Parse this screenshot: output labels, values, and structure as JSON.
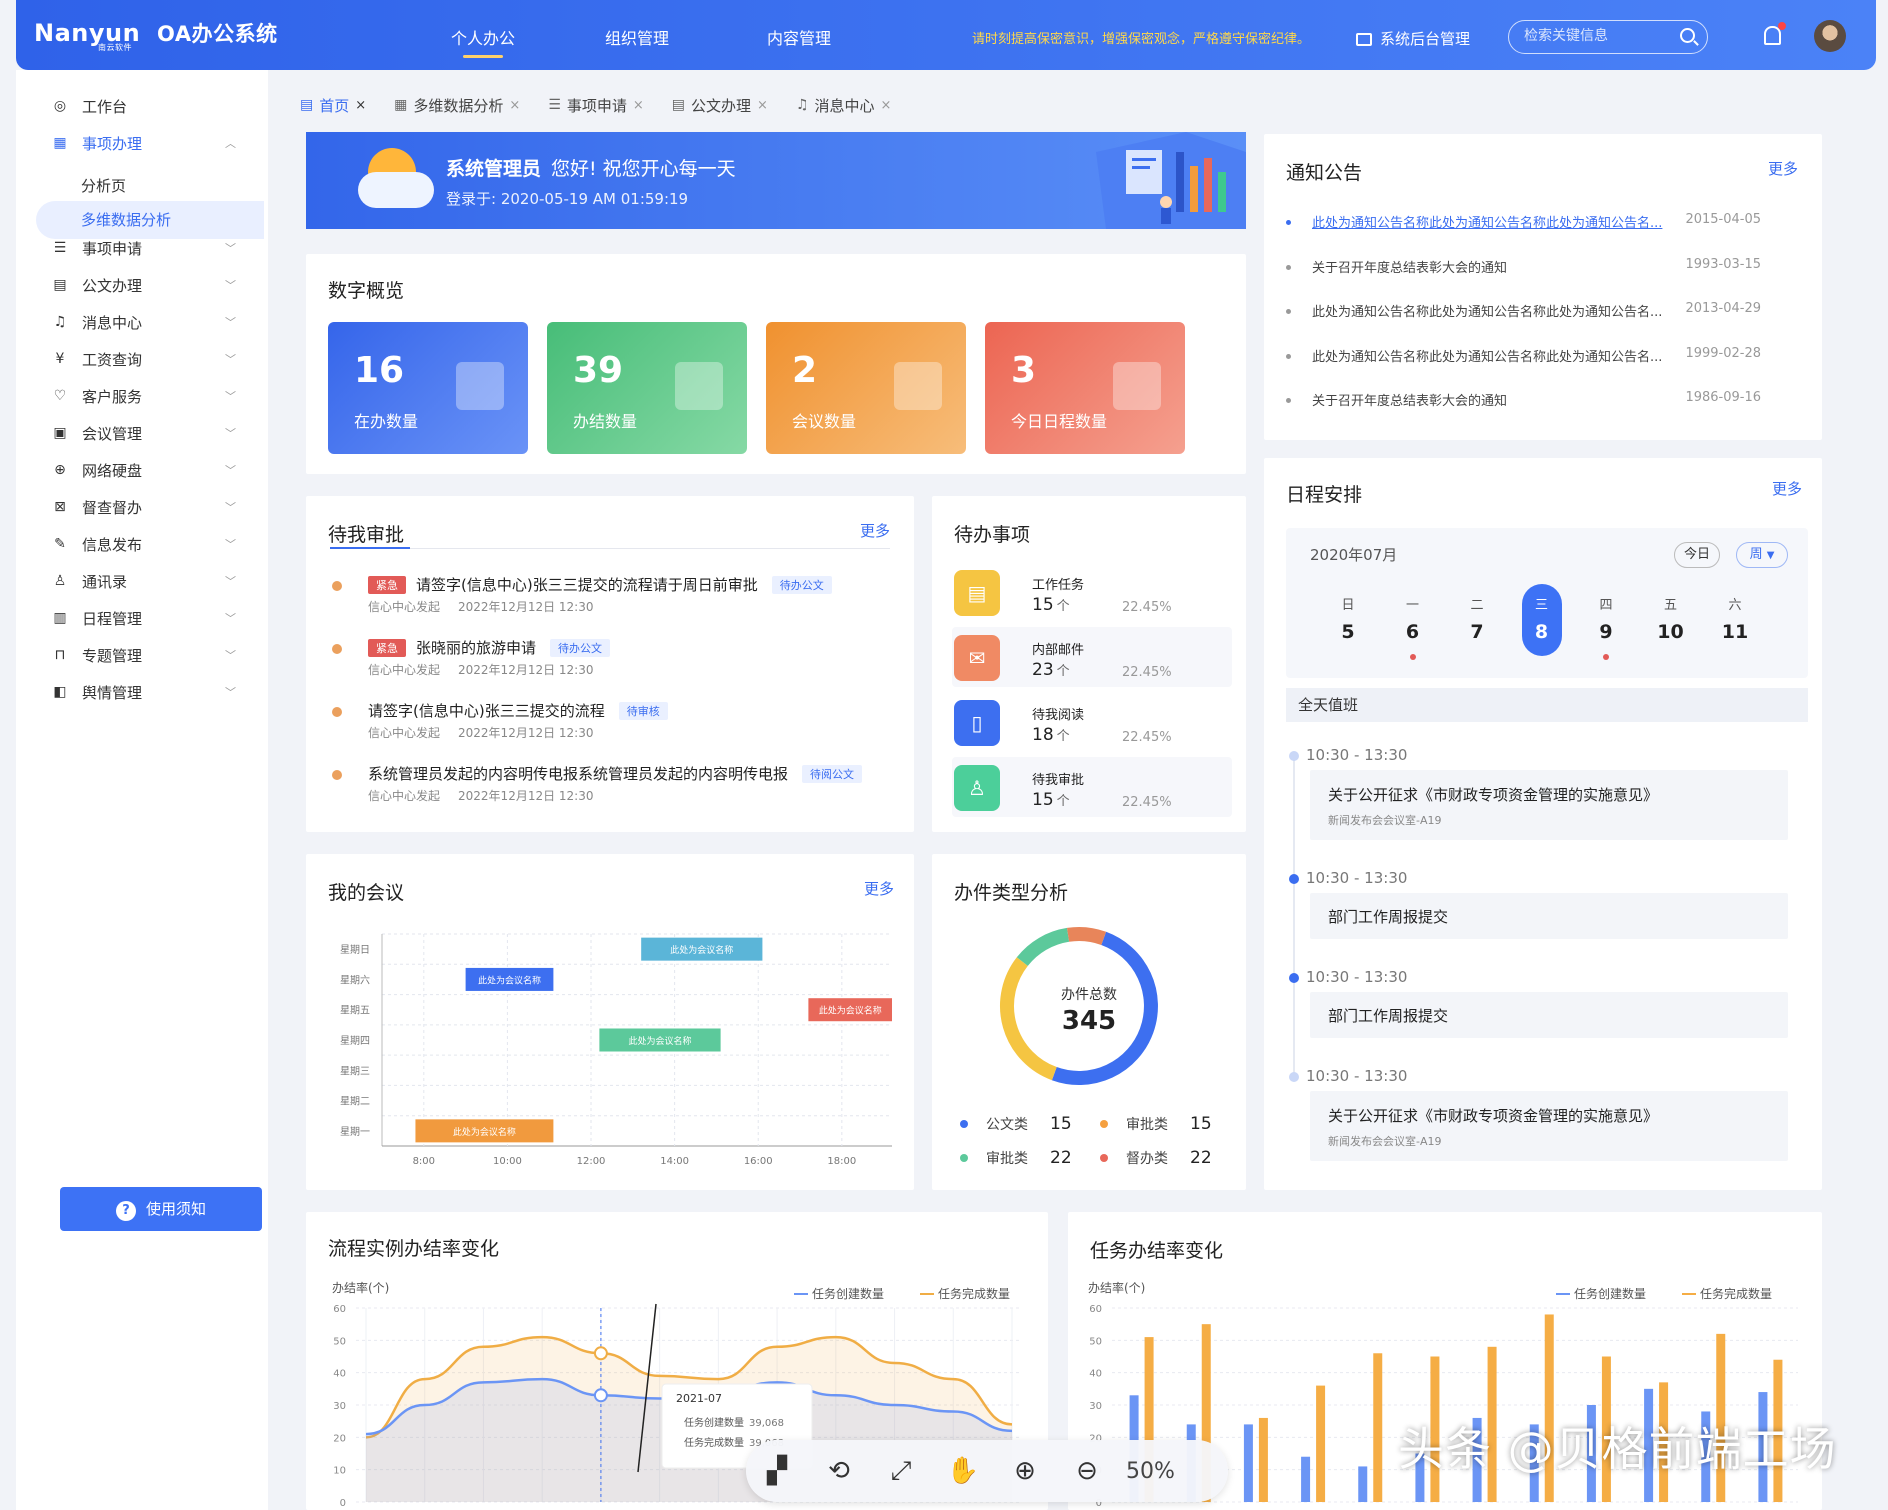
{
  "header": {
    "logo": "Nanyun",
    "logo_sub": "南云软件",
    "system_name": "OA办公系统",
    "nav": [
      "个人办公",
      "组织管理",
      "内容管理"
    ],
    "notice": "请时刻提高保密意识，增强保密观念，严格遵守保密纪律。",
    "backend": "系统后台管理",
    "search_placeholder": "检索关键信息"
  },
  "sidebar": {
    "items": [
      {
        "label": "工作台",
        "icon": "dashboard-icon",
        "glyph": "◎"
      },
      {
        "label": "事项办理",
        "icon": "grid-icon",
        "glyph": "▦",
        "expanded": true
      },
      {
        "label": "事项申请",
        "icon": "list-icon",
        "glyph": "☰"
      },
      {
        "label": "公文办理",
        "icon": "document-icon",
        "glyph": "▤"
      },
      {
        "label": "消息中心",
        "icon": "bell-icon",
        "glyph": "♫"
      },
      {
        "label": "工资查询",
        "icon": "yen-icon",
        "glyph": "¥"
      },
      {
        "label": "客户服务",
        "icon": "heart-icon",
        "glyph": "♡"
      },
      {
        "label": "会议管理",
        "icon": "presentation-icon",
        "glyph": "▣"
      },
      {
        "label": "网络硬盘",
        "icon": "globe-icon",
        "glyph": "⊕"
      },
      {
        "label": "督查督办",
        "icon": "inbox-icon",
        "glyph": "⊠"
      },
      {
        "label": "信息发布",
        "icon": "pen-icon",
        "glyph": "✎"
      },
      {
        "label": "通讯录",
        "icon": "user-icon",
        "glyph": "♙"
      },
      {
        "label": "日程管理",
        "icon": "calendar-icon",
        "glyph": "▥"
      },
      {
        "label": "专题管理",
        "icon": "bookmark-icon",
        "glyph": "⊓"
      },
      {
        "label": "舆情管理",
        "icon": "thumb-icon",
        "glyph": "◧"
      }
    ],
    "sub_items": [
      "分析页",
      "多维数据分析"
    ],
    "help": "使用须知"
  },
  "tabs": [
    {
      "label": "首页",
      "active": true
    },
    {
      "label": "多维数据分析"
    },
    {
      "label": "事项申请"
    },
    {
      "label": "公文办理"
    },
    {
      "label": "消息中心"
    }
  ],
  "welcome": {
    "name": "系统管理员",
    "greeting": "您好! 祝您开心每一天",
    "login": "登录于:  2020-05-19    AM 01:59:19"
  },
  "overview": {
    "title": "数字概览",
    "stats": [
      {
        "value": "16",
        "label": "在办数量",
        "color": "#3d6ff0"
      },
      {
        "value": "39",
        "label": "办结数量",
        "color": "#5cc686"
      },
      {
        "value": "2",
        "label": "会议数量",
        "color": "#f19a3e"
      },
      {
        "value": "3",
        "label": "今日日程数量",
        "color": "#f0725f"
      }
    ]
  },
  "approval": {
    "title": "待我审批",
    "more": "更多",
    "items": [
      {
        "urgent": "紧急",
        "title": "请签字(信息中心)张三三提交的流程请于周日前审批",
        "tag": "待办公文",
        "from": "信心中心发起",
        "time": "2022年12月12日 12:30"
      },
      {
        "urgent": "紧急",
        "title": "张晓丽的旅游申请",
        "tag": "待办公文",
        "from": "信心中心发起",
        "time": "2022年12月12日 12:30"
      },
      {
        "urgent": "",
        "title": "请签字(信息中心)张三三提交的流程",
        "tag": "待审核",
        "from": "信心中心发起",
        "time": "2022年12月12日 12:30"
      },
      {
        "urgent": "",
        "title": "系统管理员发起的内容明传电报系统管理员发起的内容明传电报",
        "tag": "待阅公文",
        "from": "信心中心发起",
        "time": "2022年12月12日 12:30"
      }
    ]
  },
  "todo": {
    "title": "待办事项",
    "items": [
      {
        "name": "工作任务",
        "count": "15",
        "unit": "个",
        "pct": "22.45%",
        "color": "#f5c542",
        "icon": "clipboard-icon"
      },
      {
        "name": "内部邮件",
        "count": "23",
        "unit": "个",
        "pct": "22.45%",
        "color": "#f08a64",
        "icon": "mail-icon"
      },
      {
        "name": "待我阅读",
        "count": "18",
        "unit": "个",
        "pct": "22.45%",
        "color": "#3d6ff0",
        "icon": "book-icon"
      },
      {
        "name": "待我审批",
        "count": "15",
        "unit": "个",
        "pct": "22.45%",
        "color": "#4ccf9a",
        "icon": "stamp-icon"
      }
    ]
  },
  "notices": {
    "title": "通知公告",
    "more": "更多",
    "items": [
      {
        "title": "此处为通知公告名称此处为通知公告名称此处为通知公告名...",
        "date": "2015-04-05"
      },
      {
        "title": "关于召开年度总结表彰大会的通知",
        "date": "1993-03-15"
      },
      {
        "title": "此处为通知公告名称此处为通知公告名称此处为通知公告名...",
        "date": "2013-04-29"
      },
      {
        "title": "此处为通知公告名称此处为通知公告名称此处为通知公告名...",
        "date": "1999-02-28"
      },
      {
        "title": "关于召开年度总结表彰大会的通知",
        "date": "1986-09-16"
      }
    ]
  },
  "schedule": {
    "title": "日程安排",
    "more": "更多",
    "month": "2020年07月",
    "today_btn": "今日",
    "view_btn": "周",
    "days": [
      {
        "w": "日",
        "d": "5",
        "dot": false
      },
      {
        "w": "一",
        "d": "6",
        "dot": true
      },
      {
        "w": "二",
        "d": "7",
        "dot": false
      },
      {
        "w": "三",
        "d": "8",
        "dot": false,
        "selected": true
      },
      {
        "w": "四",
        "d": "9",
        "dot": true
      },
      {
        "w": "五",
        "d": "10",
        "dot": false
      },
      {
        "w": "六",
        "d": "11",
        "dot": false
      }
    ],
    "allday": "全天值班",
    "events": [
      {
        "time": "10:30 - 13:30",
        "title": "关于公开征求《市财政专项资金管理的实施意见》",
        "sub": "新闻发布会会议室-A19"
      },
      {
        "time": "10:30 - 13:30",
        "title": "部门工作周报提交",
        "sub": ""
      },
      {
        "time": "10:30 - 13:30",
        "title": "部门工作周报提交",
        "sub": ""
      },
      {
        "time": "10:30 - 13:30",
        "title": "关于公开征求《市财政专项资金管理的实施意见》",
        "sub": "新闻发布会会议室-A19"
      }
    ]
  },
  "meetings": {
    "title": "我的会议",
    "more": "更多",
    "chart_data": {
      "type": "gantt",
      "rows": [
        "星期日",
        "星期六",
        "星期五",
        "星期四",
        "星期三",
        "星期二",
        "星期一"
      ],
      "x_ticks": [
        "8:00",
        "10:00",
        "12:00",
        "14:00",
        "16:00",
        "18:00"
      ],
      "xlim": [
        7,
        19.2
      ],
      "bars": [
        {
          "row": "星期日",
          "start": 13.2,
          "end": 16.1,
          "label": "此处为会议名称",
          "color": "#5bb5d8"
        },
        {
          "row": "星期六",
          "start": 9.0,
          "end": 11.1,
          "label": "此处为会议名称",
          "color": "#3d6ff0"
        },
        {
          "row": "星期五",
          "start": 17.2,
          "end": 19.2,
          "label": "此处为会议名称",
          "color": "#e8685a"
        },
        {
          "row": "星期四",
          "start": 12.2,
          "end": 15.1,
          "label": "此处为会议名称",
          "color": "#5cc99b"
        },
        {
          "row": "星期一",
          "start": 7.8,
          "end": 11.1,
          "label": "此处为会议名称",
          "color": "#f19a3e"
        }
      ]
    }
  },
  "doc_types": {
    "title": "办件类型分析",
    "center_label": "办件总数",
    "total": "345",
    "chart_data": {
      "type": "pie",
      "slices": [
        {
          "name": "公文类",
          "value": 15,
          "color": "#3d6ff0"
        },
        {
          "name": "审批类",
          "value": 15,
          "color": "#f5a040"
        },
        {
          "name": "审批类",
          "value": 22,
          "color": "#5cc99b"
        },
        {
          "name": "督办类",
          "value": 22,
          "color": "#e8685a"
        }
      ],
      "ring_share": {
        "blue": 0.5,
        "yellow": 0.3,
        "green": 0.12,
        "red": 0.08
      }
    }
  },
  "process_chart": {
    "title": "流程实例办结率变化",
    "ylabel": "办结率(个)",
    "legend": [
      "任务创建数量",
      "任务完成数量"
    ],
    "tooltip": {
      "title": "2021-07",
      "rows": [
        {
          "name": "任务创建数量",
          "value": "39,068"
        },
        {
          "name": "任务完成数量",
          "value": "39,068"
        }
      ]
    },
    "chart_data": {
      "type": "area",
      "ylim": [
        0,
        60
      ],
      "yticks": [
        0,
        10,
        20,
        30,
        40,
        50,
        60
      ],
      "series": [
        {
          "name": "任务创建数量",
          "color": "#6b95f5",
          "values": [
            21,
            30,
            37,
            38,
            33,
            32,
            34,
            37,
            33,
            30,
            28,
            22
          ]
        },
        {
          "name": "任务完成数量",
          "color": "#f0ad45",
          "values": [
            20,
            38,
            48,
            51,
            46,
            39,
            38,
            48,
            51,
            43,
            38,
            24
          ]
        }
      ]
    }
  },
  "task_chart": {
    "title": "任务办结率变化",
    "ylabel": "办结率(个)",
    "legend": [
      "任务创建数量",
      "任务完成数量"
    ],
    "chart_data": {
      "type": "bar",
      "ylim": [
        0,
        60
      ],
      "yticks": [
        0,
        10,
        20,
        30,
        40,
        50,
        60
      ],
      "series": [
        {
          "name": "任务创建数量",
          "color": "#6b95f5",
          "values": [
            33,
            24,
            24,
            14,
            11,
            15,
            26,
            24,
            30,
            35,
            28,
            34
          ]
        },
        {
          "name": "任务完成数量",
          "color": "#f5ad45",
          "values": [
            51,
            55,
            26,
            36,
            46,
            45,
            48,
            58,
            45,
            37,
            52,
            44
          ]
        }
      ]
    }
  },
  "viewer": {
    "zoom": "50%"
  },
  "watermark": "头条 @贝格前端工场"
}
